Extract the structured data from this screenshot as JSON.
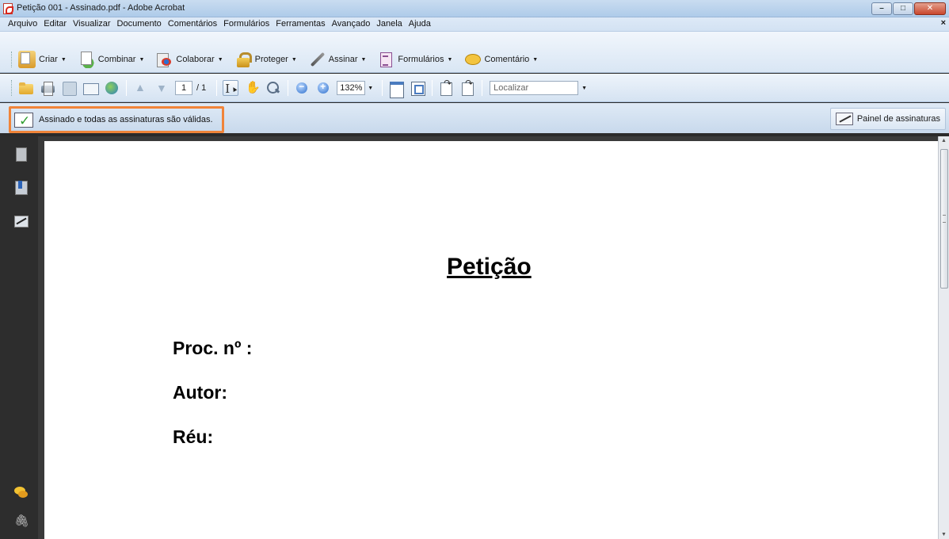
{
  "window": {
    "title": "Petição 001 - Assinado.pdf - Adobe Acrobat"
  },
  "menu": [
    "Arquivo",
    "Editar",
    "Visualizar",
    "Documento",
    "Comentários",
    "Formulários",
    "Ferramentas",
    "Avançado",
    "Janela",
    "Ajuda"
  ],
  "tasks": {
    "criar": "Criar",
    "combinar": "Combinar",
    "colaborar": "Colaborar",
    "proteger": "Proteger",
    "assinar": "Assinar",
    "formularios": "Formulários",
    "comentario": "Comentário"
  },
  "toolbar": {
    "page_current": "1",
    "page_total": "/ 1",
    "zoom": "132%",
    "find_placeholder": "Localizar"
  },
  "signature_bar": {
    "message": "Assinado e todas as assinaturas são válidas.",
    "panel_button": "Painel de assinaturas"
  },
  "document": {
    "title": "Petição",
    "fields": [
      "Proc. nº :",
      "Autor:",
      "Réu:"
    ]
  }
}
